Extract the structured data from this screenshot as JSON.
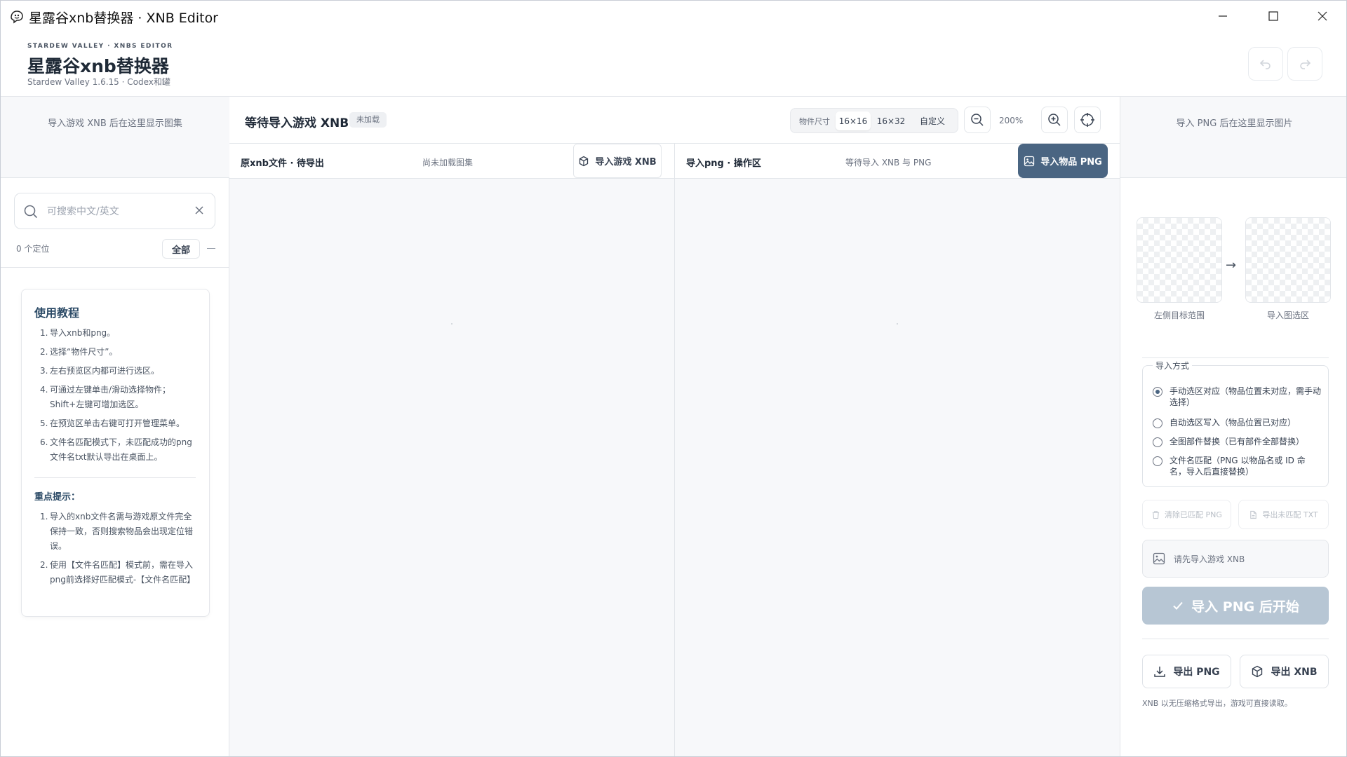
{
  "window": {
    "title": "星露谷xnb替换器 · XNB Editor"
  },
  "header": {
    "tag": "STARDEW VALLEY · XNBS EDITOR",
    "app_name": "星露谷xnb替换器",
    "subtitle": "Stardew Valley 1.6.15 · Codex和罐"
  },
  "left": {
    "top_hint": "导入游戏 XNB 后在这里显示图集",
    "search_placeholder": "可搜索中文/英文",
    "search_value": "",
    "location_count": "0 个定位",
    "all_label": "全部",
    "tutorial": {
      "title": "使用教程",
      "steps": [
        "导入xnb和png。",
        "选择“物件尺寸”。",
        "左右预览区内都可进行选区。",
        "可通过左键单击/滑动选择物件；Shift+左键可增加选区。",
        "在预览区单击右键可打开管理菜单。",
        "文件名匹配模式下，未匹配成功的png文件名txt默认导出在桌面上。"
      ],
      "key_title": "重点提示：",
      "tips": [
        "导入的xnb文件名需与游戏原文件完全保持一致，否则搜索物品会出现定位错误。",
        "使用【文件名匹配】模式前，需在导入png前选择好匹配模式-【文件名匹配】"
      ]
    }
  },
  "center": {
    "title": "等待导入游戏 XNB",
    "badge": "未加载",
    "size_label": "物件尺寸",
    "size_options": [
      "16×16",
      "16×32",
      "自定义"
    ],
    "size_selected": "16×16",
    "zoom": "200%",
    "left_pane": {
      "title": "原xnb文件 · 待导出",
      "status": "尚未加载图集",
      "button": "导入游戏 XNB"
    },
    "right_pane": {
      "title": "导入png · 操作区",
      "status": "等待导入 XNB 与 PNG",
      "button": "导入物品 PNG"
    }
  },
  "right": {
    "top_hint": "导入 PNG 后在这里显示图片",
    "thumb_left_label": "左侧目标范围",
    "thumb_right_label": "导入图选区",
    "arrow": "→",
    "mode_legend": "导入方式",
    "modes": [
      "手动选区对应（物品位置未对应，需手动选择）",
      "自动选区写入（物品位置已对应）",
      "全图部件替换（已有部件全部替换）",
      "文件名匹配（PNG 以物品名或 ID 命名，导入后直接替换）"
    ],
    "mode_selected_index": 0,
    "clear_btn": "清除已匹配 PNG",
    "export_unmatched_btn": "导出未匹配 TXT",
    "need_xnb": "请先导入游戏 XNB",
    "start_btn": "导入 PNG 后开始",
    "export_png": "导出 PNG",
    "export_xnb": "导出 XNB",
    "note": "XNB 以无压缩格式导出，游戏可直接读取。"
  },
  "colors": {
    "accent": "#4a6582",
    "start_disabled": "#b7c6d4",
    "panel_bg": "#f7f8fa",
    "border": "#e3e6ea"
  }
}
